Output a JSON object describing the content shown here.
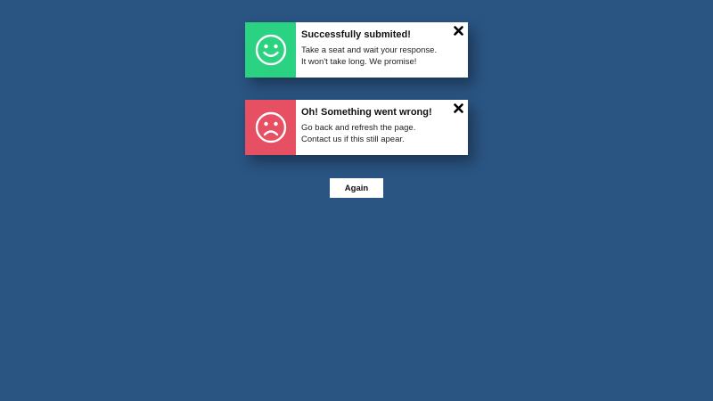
{
  "colors": {
    "background": "#2a5482",
    "success": "#2bd282",
    "error": "#e74f63",
    "card": "#ffffff"
  },
  "success_toast": {
    "icon": "smiley-face-icon",
    "title": "Successfully submited!",
    "line1": "Take a seat and wait your response.",
    "line2": "It won't take long. We promise!",
    "close_icon": "close-x-icon"
  },
  "error_toast": {
    "icon": "sad-face-icon",
    "title": "Oh! Something went wrong!",
    "line1": "Go back and refresh the page.",
    "line2": "Contact us if this still apear.",
    "close_icon": "close-x-icon"
  },
  "again_button": {
    "label": "Again"
  }
}
